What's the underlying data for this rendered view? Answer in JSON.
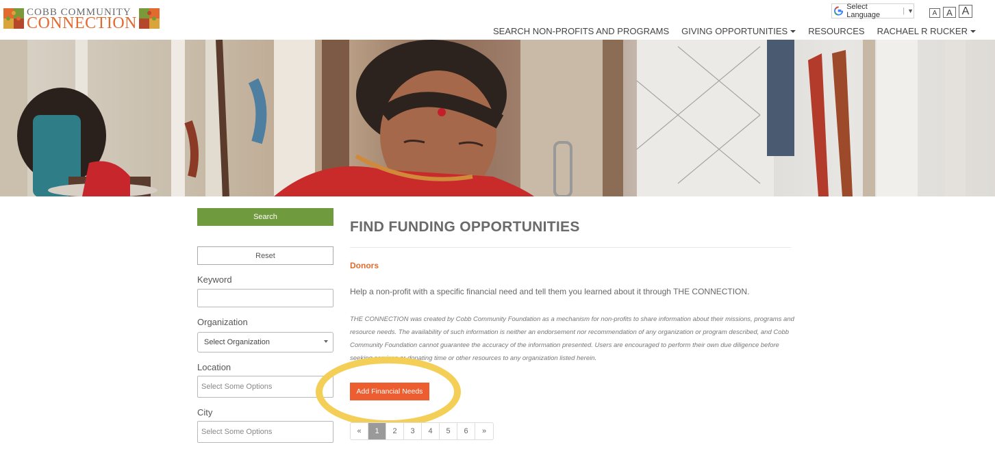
{
  "logo": {
    "line1": "COBB COMMUNITY",
    "line2": "CONNECTION"
  },
  "translate": {
    "label": "Select Language",
    "separator": "|",
    "arrow": "▼"
  },
  "font_size_buttons": [
    "A",
    "A",
    "A"
  ],
  "nav": {
    "items": [
      {
        "label": "SEARCH NON-PROFITS AND PROGRAMS",
        "dropdown": false
      },
      {
        "label": "GIVING OPPORTUNITIES",
        "dropdown": true
      },
      {
        "label": "RESOURCES",
        "dropdown": false
      },
      {
        "label": "RACHAEL R RUCKER",
        "dropdown": true
      }
    ]
  },
  "sidebar": {
    "search_label": "Search",
    "reset_label": "Reset",
    "keyword_label": "Keyword",
    "keyword_value": "",
    "organization_label": "Organization",
    "organization_value": "Select Organization",
    "location_label": "Location",
    "location_placeholder": "Select Some Options",
    "city_label": "City",
    "city_placeholder": "Select Some Options"
  },
  "main": {
    "title": "FIND FUNDING OPPORTUNITIES",
    "section_label": "Donors",
    "lead": "Help a non-profit with a specific financial need and tell them you learned about it through THE CONNECTION.",
    "disclaimer": "THE CONNECTION was created by Cobb Community Foundation as a mechanism for non-profits to share information about their missions, programs and resource needs.  The availability of such information is neither an endorsement nor recommendation of any organization or program described, and Cobb Community Foundation cannot guarantee the accuracy of the information presented.  Users are encouraged to perform their own due diligence before seeking services or donating time or other resources to any organization listed herein.",
    "add_button": "Add Financial Needs"
  },
  "pagination": {
    "prev": "«",
    "pages": [
      "1",
      "2",
      "3",
      "4",
      "5",
      "6"
    ],
    "current": "1",
    "next": "»"
  },
  "colors": {
    "accent_orange": "#e36a2e",
    "button_orange": "#ec5d2f",
    "search_green": "#6f9a3d",
    "highlight_yellow": "#f4cf57"
  }
}
